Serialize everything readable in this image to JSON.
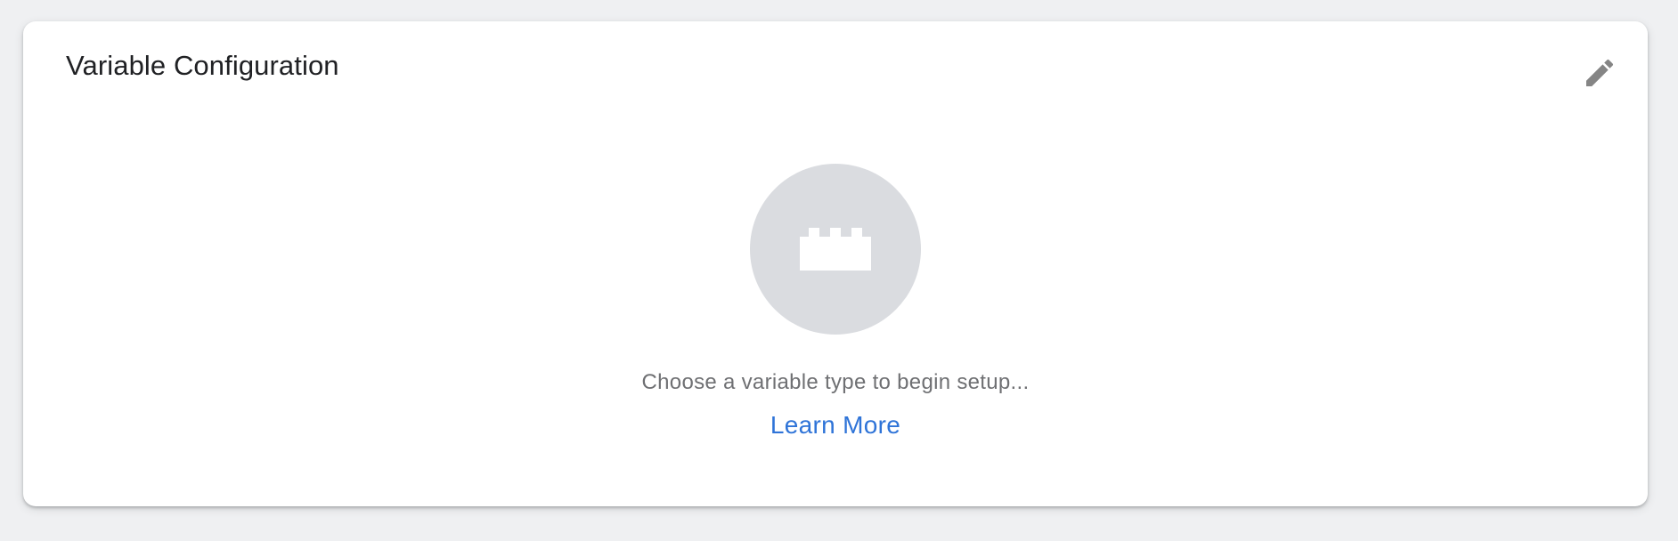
{
  "card": {
    "title": "Variable Configuration",
    "edit_icon": "pencil-icon",
    "placeholder_icon": "building-block-icon",
    "hint": "Choose a variable type to begin setup...",
    "learn_more": "Learn More"
  },
  "colors": {
    "page_background": "#eff0f2",
    "card_background": "#ffffff",
    "placeholder_circle": "#dadce0",
    "link": "#2f74d8",
    "icon": "#858585"
  }
}
